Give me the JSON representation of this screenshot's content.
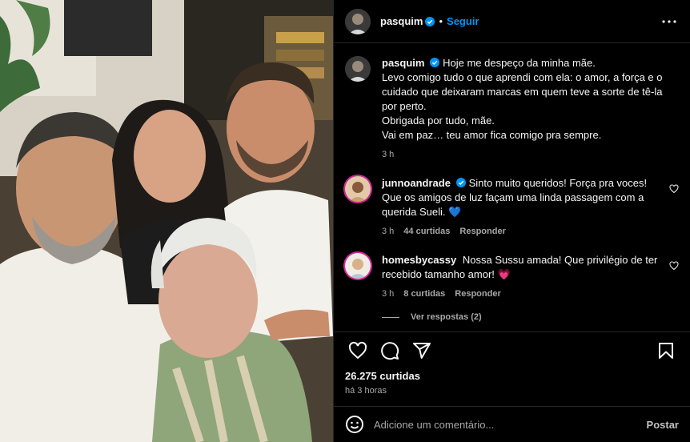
{
  "post": {
    "author": "pasquim",
    "follow_label": "Seguir",
    "separator": "•",
    "caption_lines": [
      "Hoje me despeço da minha mãe.",
      "Levo comigo tudo o que aprendi com ela: o amor, a força e o cuidado que deixaram marcas em quem teve a sorte de tê-la por perto.",
      "Obrigada por tudo, mãe.",
      "Vai em paz… teu amor fica comigo pra sempre."
    ],
    "caption_time": "3 h",
    "likes": "26.275 curtidas",
    "posted_ago": "há 3 horas"
  },
  "comments": [
    {
      "user": "junnoandrade",
      "verified": true,
      "text": "Sinto muito queridos! Força pra voces! Que os amigos de luz façam uma linda passagem com a querida Sueli. 💙",
      "time": "3 h",
      "likes": "44 curtidas",
      "reply": "Responder"
    },
    {
      "user": "homesbycassy",
      "verified": false,
      "text": "Nossa Sussu amada! Que privilégio de ter recebido tamanho amor! 💗",
      "time": "3 h",
      "likes": "8 curtidas",
      "reply": "Responder"
    }
  ],
  "view_replies": "Ver respostas (2)",
  "add_comment": {
    "placeholder": "Adicione um comentário...",
    "post_label": "Postar"
  },
  "icons": {
    "more": "more-horizontal-icon",
    "like": "heart-icon",
    "comment": "comment-icon",
    "share": "paper-plane-icon",
    "save": "bookmark-icon",
    "emoji": "emoji-icon",
    "verified": "verified-badge-icon"
  },
  "colors": {
    "background": "#000000",
    "text": "#f5f5f5",
    "muted": "#a8a8a8",
    "accent": "#0095f6",
    "verified": "#0095f6"
  }
}
